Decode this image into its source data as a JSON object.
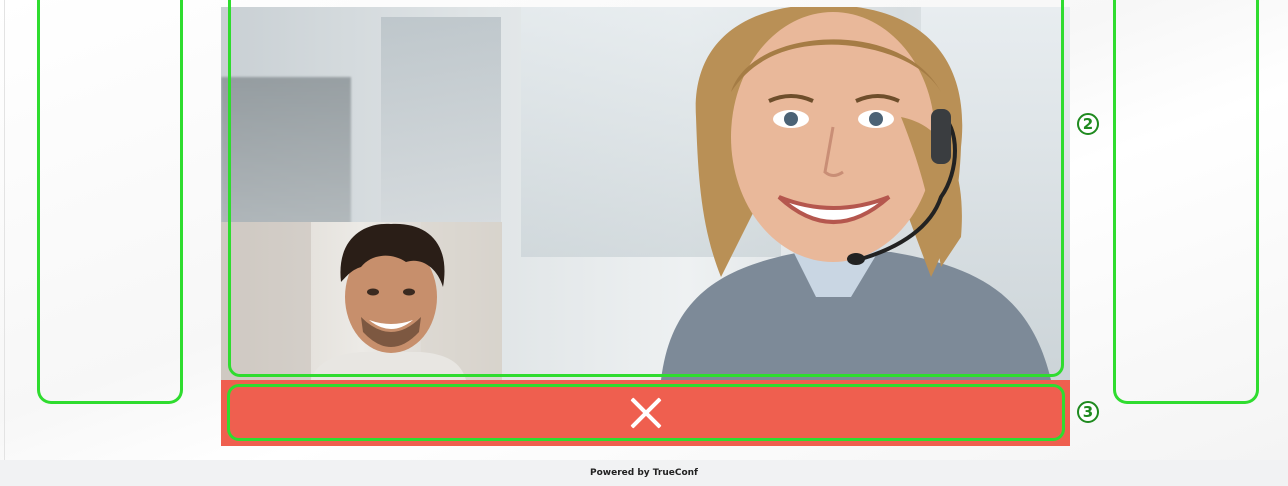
{
  "video": {
    "remote_participant": "remote-video",
    "self_participant": "self-view"
  },
  "controls": {
    "hangup_icon": "close-icon"
  },
  "annotations": {
    "callout_video": "2",
    "callout_hangup": "3"
  },
  "footer": {
    "text": "Powered by TrueConf"
  },
  "colors": {
    "highlight": "#2fdc2f",
    "hangup": "#ef5f4f",
    "callout": "#1f8a1f"
  }
}
